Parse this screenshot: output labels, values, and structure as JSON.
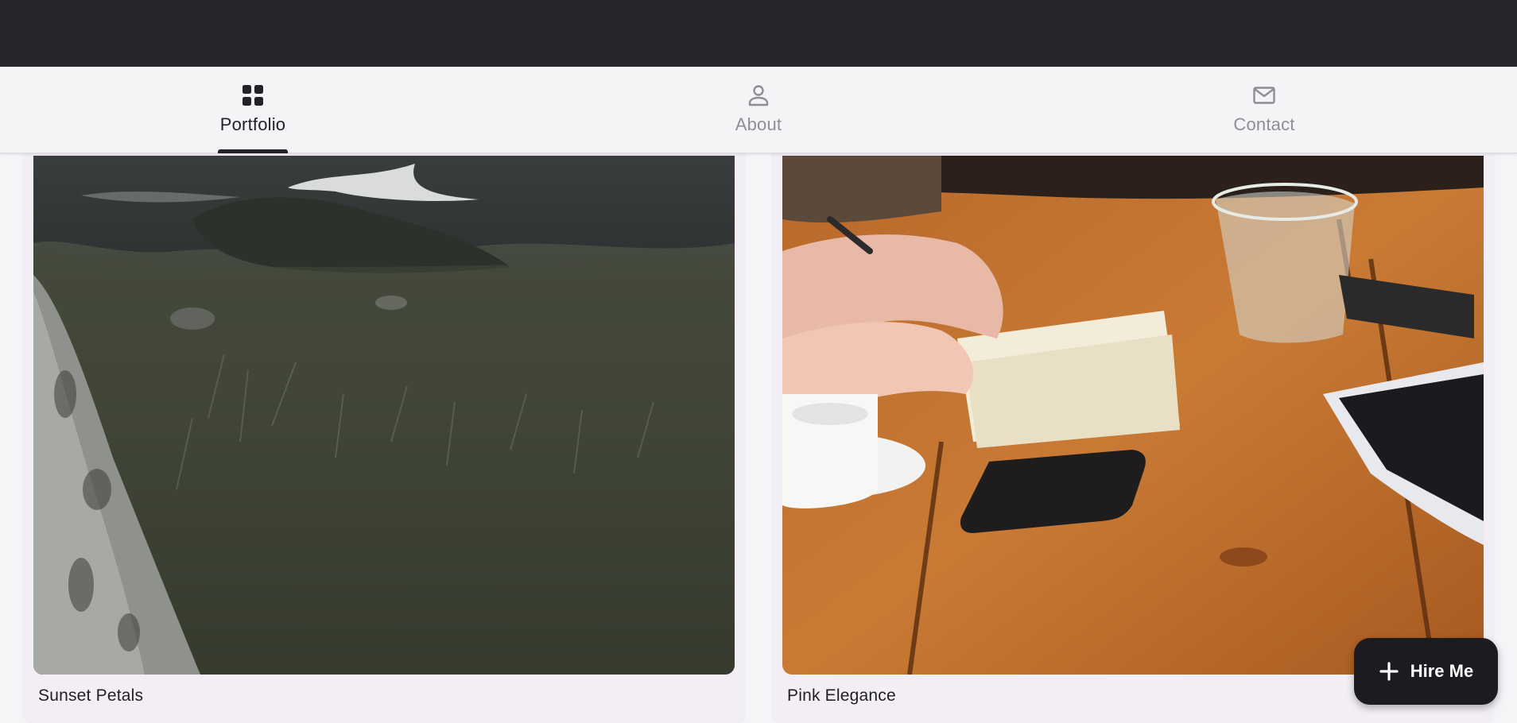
{
  "app": {
    "colors": {
      "appbar": "#27262c",
      "active": "#222228",
      "inactive": "#8e8e93",
      "card": "#f3eef6"
    }
  },
  "tabs": [
    {
      "label": "Portfolio",
      "icon": "grid-icon",
      "active": true
    },
    {
      "label": "About",
      "icon": "person-icon",
      "active": false
    },
    {
      "label": "Contact",
      "icon": "mail-icon",
      "active": false
    }
  ],
  "portfolio": {
    "items": [
      {
        "title": "Sunset Petals",
        "image": "landscape photo of grassy hillside with lake"
      },
      {
        "title": "Pink Elegance",
        "image": "photo of hands writing in notebook at wooden table with coffee, glass and phones"
      }
    ]
  },
  "fab": {
    "label": "Hire Me",
    "icon": "plus-icon"
  }
}
